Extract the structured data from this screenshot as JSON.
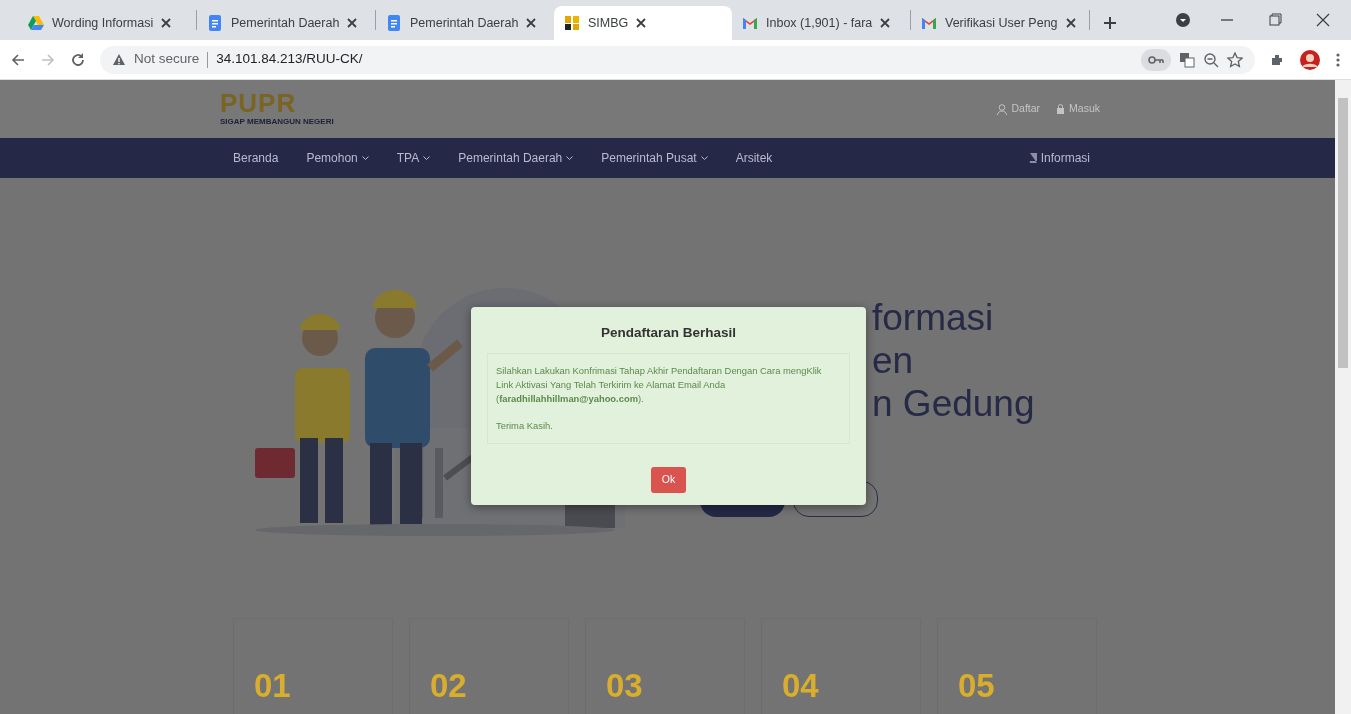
{
  "browser": {
    "tabs": [
      {
        "title": "Wording Informasi",
        "kind": "drive",
        "selected": false
      },
      {
        "title": "Pemerintah Daerah",
        "kind": "docs",
        "selected": false
      },
      {
        "title": "Pemerintah Daerah",
        "kind": "docs",
        "selected": false
      },
      {
        "title": "SIMBG",
        "kind": "pupr",
        "selected": true
      },
      {
        "title": "Inbox (1,901) - fara",
        "kind": "gmail",
        "selected": false
      },
      {
        "title": "Verifikasi User Peng",
        "kind": "gmail",
        "selected": false
      }
    ],
    "security": "Not secure",
    "url": "34.101.84.213/RUU-CK/"
  },
  "header": {
    "logo": "PUPR",
    "tagline": "SIGAP MEMBANGUN NEGERI",
    "links": [
      "Daftar",
      "Masuk"
    ]
  },
  "nav": {
    "items": [
      {
        "label": "Beranda",
        "dropdown": false
      },
      {
        "label": "Pemohon",
        "dropdown": true
      },
      {
        "label": "TPA",
        "dropdown": true
      },
      {
        "label": "Pemerintah Daerah",
        "dropdown": true
      },
      {
        "label": "Pemerintah Pusat",
        "dropdown": true
      },
      {
        "label": "Arsitek",
        "dropdown": false
      }
    ],
    "right": "Informasi"
  },
  "hero": {
    "heading_lines": [
      "formasi",
      "en",
      "n Gedung"
    ],
    "buttons": [
      {
        "kind": "filled"
      },
      {
        "kind": "outline"
      }
    ]
  },
  "steps": [
    "01",
    "02",
    "03",
    "04",
    "05"
  ],
  "modal": {
    "title": "Pendaftaran Berhasil",
    "message": "Silahkan Lakukan Konfrimasi Tahap Akhir Pendaftaran Dengan Cara mengKlik Link Aktivasi Yang Telah Terkirim ke Alamat Email Anda (**faradhillahhillman@yahoo.com**).",
    "closing": "Terima Kasih.",
    "button": "Ok"
  }
}
